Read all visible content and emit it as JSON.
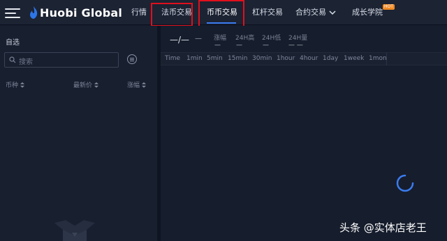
{
  "header": {
    "logo_text": "Huobi Global",
    "nav": [
      {
        "label": "行情"
      },
      {
        "label": "法币交易"
      },
      {
        "label": "币币交易"
      },
      {
        "label": "杠杆交易"
      },
      {
        "label": "合约交易"
      },
      {
        "label": "成长学院"
      }
    ],
    "hot_badge": "HOT",
    "accent_color": "#3a7cf0",
    "highlight_color": "#e0101c"
  },
  "sidebar": {
    "favorites_label": "自选",
    "search": {
      "placeholder": "搜索"
    },
    "columns": [
      {
        "label": "币种"
      },
      {
        "label": "最新价"
      },
      {
        "label": "涨幅"
      }
    ]
  },
  "ticker": {
    "price": "—/—",
    "sub_price": "—",
    "stats": [
      {
        "label": "涨幅",
        "value": "—"
      },
      {
        "label": "24H高",
        "value": "—"
      },
      {
        "label": "24H低",
        "value": "—"
      },
      {
        "label": "24H量",
        "value": "— —"
      }
    ]
  },
  "timeframes": [
    "Time",
    "1min",
    "5min",
    "15min",
    "30min",
    "1hour",
    "4hour",
    "1day",
    "1week",
    "1mon"
  ],
  "watermark": "头条 @实体店老王"
}
